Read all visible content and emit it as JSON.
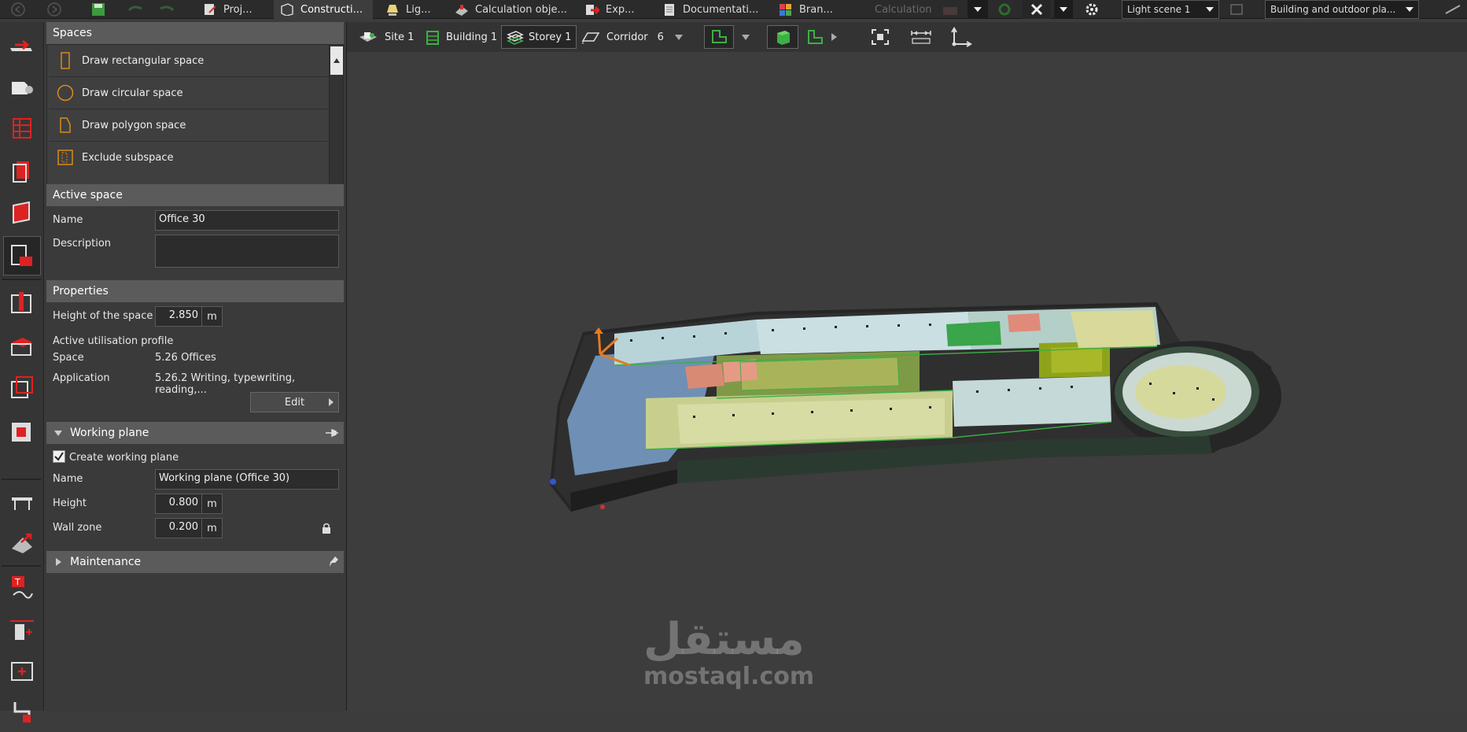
{
  "topbar": {
    "tabs": [
      {
        "label": "Proj...",
        "icon": "project-icon"
      },
      {
        "label": "Constructi...",
        "icon": "construction-icon"
      },
      {
        "label": "Lig...",
        "icon": "light-icon"
      },
      {
        "label": "Calculation obje...",
        "icon": "calculation-objects-icon"
      },
      {
        "label": "Exp...",
        "icon": "export-icon"
      },
      {
        "label": "Documentati...",
        "icon": "documentation-icon"
      },
      {
        "label": "Bran...",
        "icon": "brand-icon"
      }
    ],
    "calculation_label": "Calculation",
    "light_scene": "Light scene 1",
    "view_select": "Building and outdoor pla..."
  },
  "spaces_panel": {
    "title": "Spaces",
    "items": [
      {
        "label": "Draw rectangular space"
      },
      {
        "label": "Draw circular space"
      },
      {
        "label": "Draw polygon space"
      },
      {
        "label": "Exclude subspace"
      }
    ]
  },
  "active_space": {
    "title": "Active space",
    "name_label": "Name",
    "name_value": "Office 30",
    "description_label": "Description",
    "description_value": ""
  },
  "properties": {
    "title": "Properties",
    "height_label": "Height of the space",
    "height_value": "2.850",
    "unit": "m",
    "profile_label": "Active utilisation profile",
    "space_label": "Space",
    "space_value": "5.26 Offices",
    "application_label": "Application",
    "application_value": "5.26.2 Writing, typewriting, reading,...",
    "edit_label": "Edit"
  },
  "working_plane": {
    "title": "Working plane",
    "create_label": "Create working plane",
    "create_checked": true,
    "name_label": "Name",
    "name_value": "Working plane (Office 30)",
    "height_label": "Height",
    "height_value": "0.800",
    "wall_zone_label": "Wall zone",
    "wall_zone_value": "0.200",
    "unit": "m"
  },
  "maintenance": {
    "title": "Maintenance"
  },
  "viewbar": {
    "site": "Site 1",
    "building": "Building 1",
    "storey": "Storey 1",
    "corridor": "Corridor",
    "corridor_count": "6"
  },
  "watermark": {
    "arabic": "مستقل",
    "latin": "mostaql.com"
  },
  "colors": {
    "accent_red": "#d42a2a",
    "accent_green": "#3cb043",
    "accent_orange": "#d98c1a"
  }
}
